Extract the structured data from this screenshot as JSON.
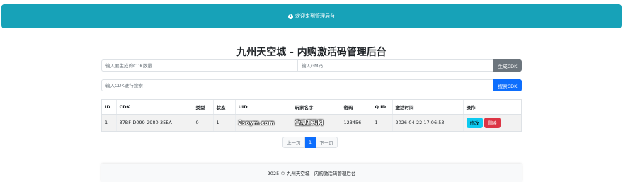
{
  "alert": {
    "icon": "info-circle-icon",
    "text": "欢迎来到管理后台"
  },
  "title": "九州天空城 - 内购激活码管理后台",
  "generate": {
    "count_placeholder": "输入要生成的CDK数量",
    "gm_placeholder": "输入GM码",
    "button": "生成CDK"
  },
  "search": {
    "placeholder": "输入CDK进行搜索",
    "button": "搜索CDK"
  },
  "table": {
    "headers": [
      "ID",
      "CDK",
      "类型",
      "状态",
      "UID",
      "玩家名字",
      "密码",
      "Q ID",
      "激活时间",
      "操作"
    ],
    "rows": [
      {
        "id": "1",
        "cdk": "37BF-D099-2980-35EA",
        "type": "0",
        "status": "1",
        "uid": "2soym.com",
        "player": "爱搜源码网",
        "password": "123456",
        "qid": "1",
        "time": "2026-04-22 17:06:53",
        "edit": "修改",
        "delete": "删除"
      }
    ]
  },
  "pager": {
    "prev": "上一页",
    "current": "1",
    "next": "下一页"
  },
  "footer": "2025 © 九州天空城 - 内购激活码管理后台",
  "colors": {
    "alert": "#17a2b8",
    "primary": "#0d6efd",
    "secondary": "#6c757d",
    "info": "#0dcaf0",
    "danger": "#dc3545"
  }
}
